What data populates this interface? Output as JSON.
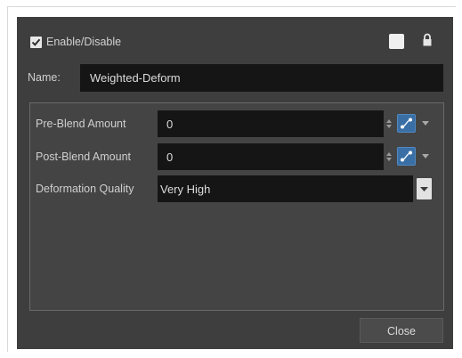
{
  "header": {
    "enable_label": "Enable/Disable",
    "enabled": true,
    "color_swatch": "#f0f0f0",
    "lock_icon": "lock-icon"
  },
  "name_field": {
    "label": "Name:",
    "value": "Weighted-Deform"
  },
  "properties": [
    {
      "label": "Pre-Blend Amount",
      "value": "0",
      "icons": [
        "spinner-icon",
        "function-curve-icon",
        "dropdown-arrow-icon"
      ]
    },
    {
      "label": "Post-Blend Amount",
      "value": "0",
      "icons": [
        "spinner-icon",
        "function-curve-icon",
        "dropdown-arrow-icon"
      ]
    },
    {
      "label": "Deformation Quality",
      "value": "Very High",
      "icons": [
        "dropdown-arrow-icon"
      ]
    }
  ],
  "footer": {
    "close_label": "Close"
  },
  "colors": {
    "dialog_bg": "#3e3e3e",
    "field_bg": "#151515",
    "accent_blue": "#3a6fa6"
  }
}
